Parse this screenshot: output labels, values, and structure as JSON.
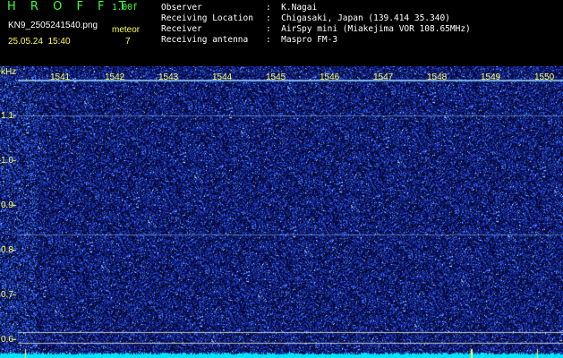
{
  "header": {
    "app_title": "H R O F F T",
    "version": "1.00f",
    "file_name": "KN9_2505241540.png",
    "meteor_label": "meteor",
    "date_time": "25.05.24  15:40",
    "meteor_count": "7"
  },
  "meta": {
    "rows": [
      {
        "key": "Observer",
        "value": ":  K.Nagai"
      },
      {
        "key": "Receiving Location",
        "value": ":  Chigasaki, Japan (139.414 35.340)"
      },
      {
        "key": "Receiver",
        "value": ":  AirSpy mini (Miakejima VOR 108.65MHz)"
      },
      {
        "key": "Receiving antenna",
        "value": ":  Maspro FM-3"
      }
    ]
  },
  "chart_data": {
    "type": "heatmap",
    "ylabel": "kHz",
    "y_ticks": [
      "1.1",
      "1.0",
      "0.9",
      "0.8",
      "0.7",
      "0.6"
    ],
    "x_ticks": [
      "1541",
      "1542",
      "1543",
      "1544",
      "1545",
      "1546",
      "1547",
      "1548",
      "1549",
      "1550"
    ],
    "colors": {
      "background": "#060a3a",
      "noise": "#2a52ff",
      "line": "#9ad8ff",
      "baseline": "#00e5ff",
      "label": "#ffff55"
    }
  }
}
